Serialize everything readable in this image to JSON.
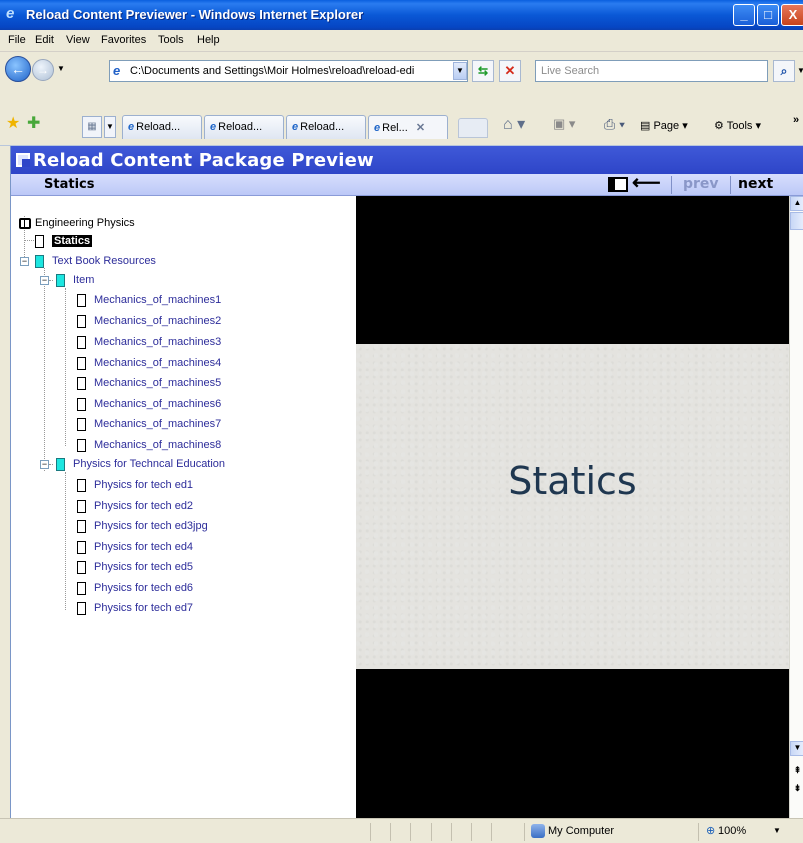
{
  "window": {
    "title": "Reload Content Previewer - Windows Internet Explorer",
    "minimize_glyph": "_",
    "maximize_glyph": "□",
    "close_glyph": "X"
  },
  "menu": [
    "File",
    "Edit",
    "View",
    "Favorites",
    "Tools",
    "Help"
  ],
  "address": {
    "url": "C:\\Documents and Settings\\Moir Holmes\\reload\\reload-edi"
  },
  "search": {
    "placeholder": "Live Search"
  },
  "tabs": [
    {
      "label": "Reload..."
    },
    {
      "label": "Reload..."
    },
    {
      "label": "Reload..."
    },
    {
      "label": "Rel..."
    }
  ],
  "commands": {
    "page_label": "Page",
    "tools_label": "Tools",
    "more": "»"
  },
  "preview": {
    "header_title": "Reload Content Package Preview",
    "current_item": "Statics",
    "prev_label": "prev",
    "next_label": "next"
  },
  "tree": {
    "root": "Engineering Physics",
    "items": [
      {
        "label": "Statics",
        "selected": true
      },
      {
        "label": "Text Book Resources"
      },
      {
        "label": "Item"
      },
      {
        "label": "Mechanics_of_machines1"
      },
      {
        "label": "Mechanics_of_machines2"
      },
      {
        "label": "Mechanics_of_machines3"
      },
      {
        "label": "Mechanics_of_machines4"
      },
      {
        "label": "Mechanics_of_machines5"
      },
      {
        "label": "Mechanics_of_machines6"
      },
      {
        "label": "Mechanics_of_machines7"
      },
      {
        "label": "Mechanics_of_machines8"
      },
      {
        "label": "Physics for Techncal Education"
      },
      {
        "label": "Physics for tech ed1"
      },
      {
        "label": "Physics for tech ed2"
      },
      {
        "label": "Physics for tech ed3jpg"
      },
      {
        "label": "Physics for tech ed4"
      },
      {
        "label": "Physics for tech ed5"
      },
      {
        "label": "Physics for tech ed6"
      },
      {
        "label": "Physics for tech ed7"
      }
    ]
  },
  "slide": {
    "title": "Statics"
  },
  "status": {
    "zone": "My Computer",
    "zoom": "100%"
  },
  "colors": {
    "titlebar": "#0a58d6",
    "preview_header": "#2e45c8",
    "nav_strip": "#c8d2fa",
    "tree_link": "#2d2d9a",
    "folder_node": "#1de6e0"
  }
}
